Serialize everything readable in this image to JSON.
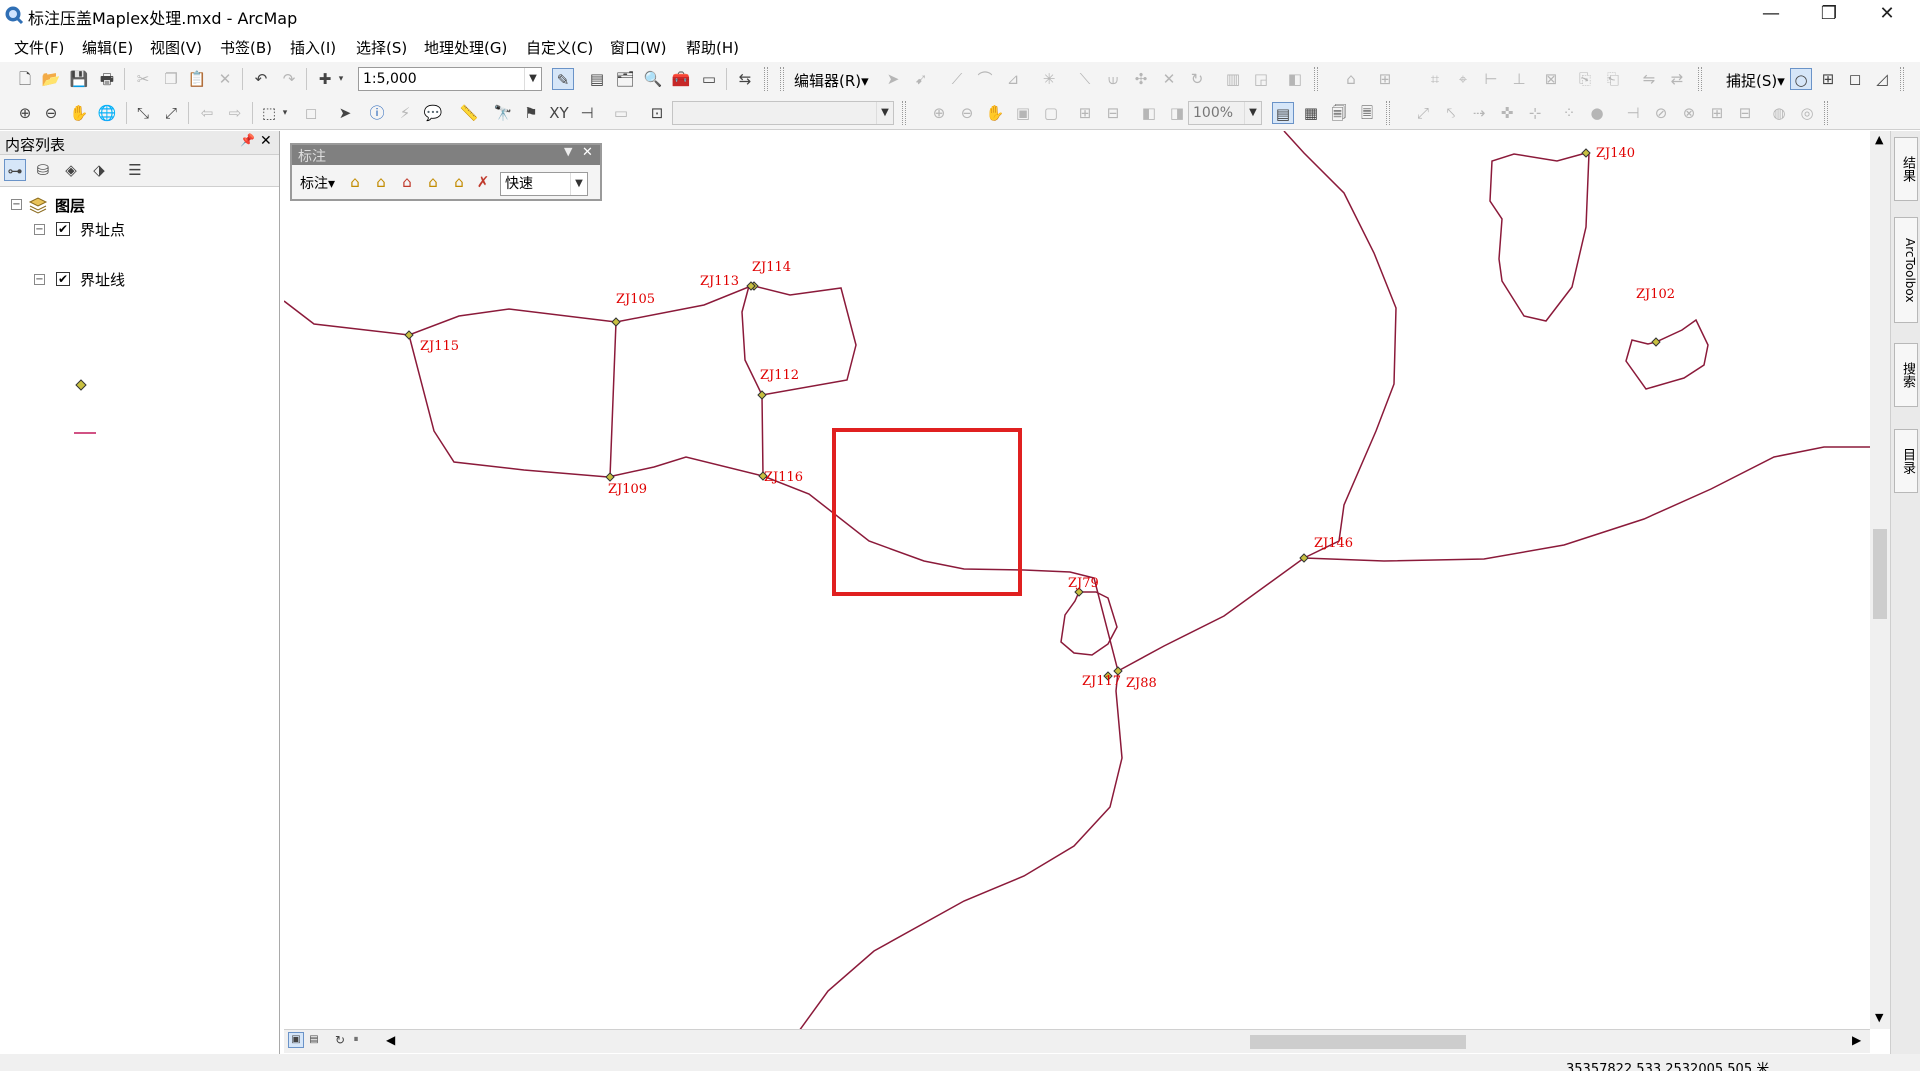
{
  "window": {
    "title": "标注压盖Maplex处理.mxd - ArcMap",
    "controls": {
      "minimize": "—",
      "maximize": "❐",
      "close": "✕"
    }
  },
  "menu": [
    "文件(F)",
    "编辑(E)",
    "视图(V)",
    "书签(B)",
    "插入(I)",
    "选择(S)",
    "地理处理(G)",
    "自定义(C)",
    "窗口(W)",
    "帮助(H)"
  ],
  "toolbar": {
    "scale": "1:5,000",
    "editor_label": "编辑器(R)▾",
    "snapping_label": "捕捉(S)▾",
    "zoom_percent": "100%",
    "scale_placeholder": ""
  },
  "labeling_toolbar": {
    "title": "标注",
    "label_menu": "标注▾",
    "mode_value": "快速"
  },
  "toc": {
    "title": "内容列表",
    "pin": "📌",
    "close": "✕",
    "group": "图层",
    "layers": [
      {
        "name": "界址点",
        "checked": true,
        "symbol": "point"
      },
      {
        "name": "界址线",
        "checked": true,
        "symbol": "line"
      }
    ]
  },
  "map": {
    "line_color": "#8b1a3a",
    "label_color": "#e00000",
    "highlight_color": "#e02020",
    "labels": [
      "ZJ140",
      "ZJ102",
      "ZJ114",
      "ZJ113",
      "ZJ105",
      "ZJ115",
      "ZJ112",
      "ZJ116",
      "ZJ109",
      "ZJ146",
      "ZJ79",
      "ZJ117",
      "ZJ88"
    ]
  },
  "right_dock": [
    "结果",
    "ArcToolbox",
    "搜索",
    "目录"
  ],
  "status": {
    "coordinates": "35357822.533  2532005.505 米"
  }
}
